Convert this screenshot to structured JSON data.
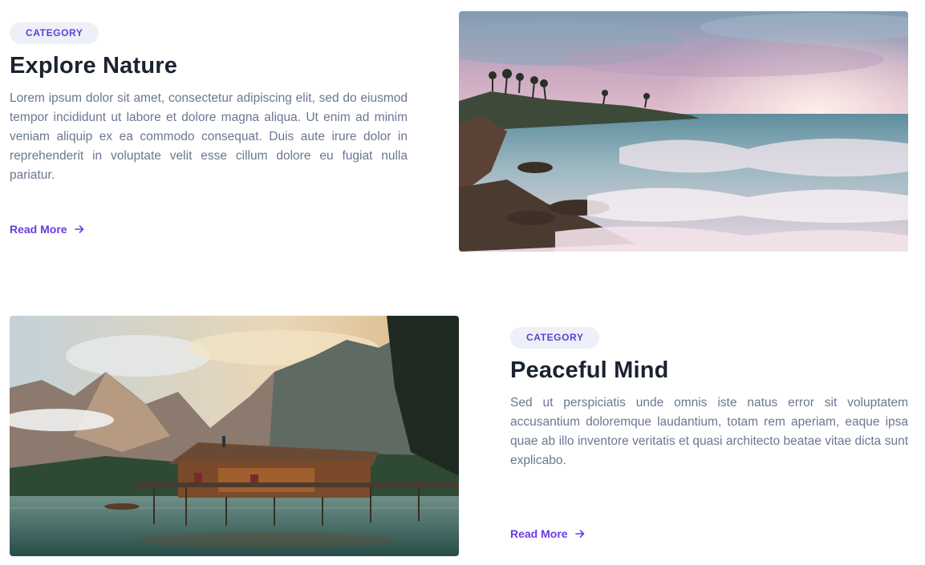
{
  "cards": [
    {
      "category": "CATEGORY",
      "title": "Explore Nature",
      "body": "Lorem ipsum dolor sit amet, consectetur adipiscing elit, sed do eiusmod tempor incididunt ut labore et dolore magna aliqua. Ut enim ad minim veniam  aliquip ex ea commodo consequat. Duis aute irure dolor in reprehenderit in voluptate velit esse cillum dolore eu fugiat nulla pariatur.",
      "link_label": "Read More",
      "link_icon": "arrow-right-icon",
      "image": "coastal-sunset-waves-photo"
    },
    {
      "category": "CATEGORY",
      "title": "Peaceful Mind",
      "body": "Sed ut perspiciatis unde omnis iste natus error sit voluptatem accusantium doloremque laudantium, totam rem aperiam, eaque ipsa quae ab illo inventore veritatis et quasi architecto beatae vitae dicta sunt explicabo.",
      "link_label": "Read More",
      "link_icon": "arrow-right-icon",
      "image": "mountain-lake-boathouse-photo"
    }
  ],
  "colors": {
    "accent": "#6a3ce0",
    "badge_bg": "#edf0f7",
    "title": "#1b2230",
    "body": "#6b7791"
  }
}
